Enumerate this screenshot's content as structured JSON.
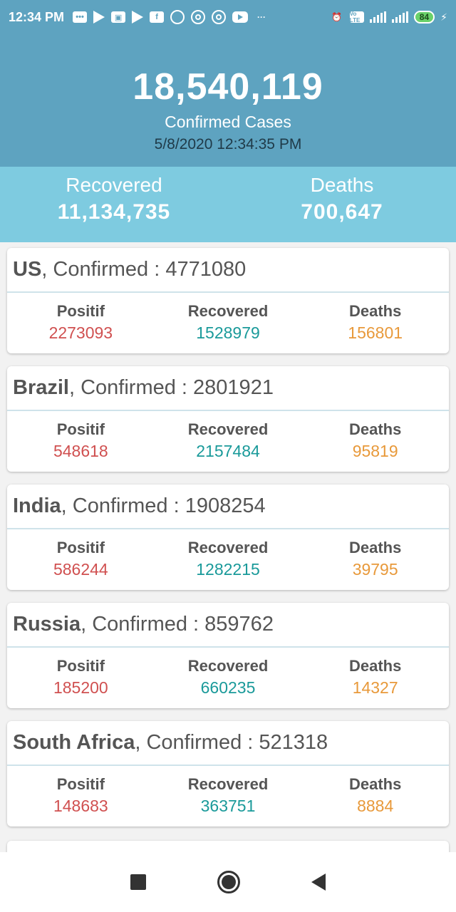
{
  "status_bar": {
    "time": "12:34 PM",
    "icons": [
      "message-icon",
      "play-store-icon",
      "gallery-icon",
      "play-store-icon",
      "facebook-icon",
      "messenger-icon",
      "circle-icon",
      "circle-icon",
      "youtube-icon",
      "more-icon"
    ],
    "more": "···",
    "volte": "Vo LTE",
    "network": "4G",
    "battery": "84"
  },
  "header": {
    "total": "18,540,119",
    "total_label": "Confirmed Cases",
    "updated": "5/8/2020 12:34:35 PM"
  },
  "summary": {
    "recovered_label": "Recovered",
    "recovered_value": "11,134,735",
    "deaths_label": "Deaths",
    "deaths_value": "700,647"
  },
  "labels": {
    "confirmed_prefix": ", Confirmed : ",
    "positif": "Positif",
    "recovered": "Recovered",
    "deaths": "Deaths"
  },
  "countries": [
    {
      "name": "US",
      "confirmed": "4771080",
      "positif": "2273093",
      "recovered": "1528979",
      "deaths": "156801"
    },
    {
      "name": "Brazil",
      "confirmed": "2801921",
      "positif": "548618",
      "recovered": "2157484",
      "deaths": "95819"
    },
    {
      "name": "India",
      "confirmed": "1908254",
      "positif": "586244",
      "recovered": "1282215",
      "deaths": "39795"
    },
    {
      "name": "Russia",
      "confirmed": "859762",
      "positif": "185200",
      "recovered": "660235",
      "deaths": "14327"
    },
    {
      "name": "South Africa",
      "confirmed": "521318",
      "positif": "148683",
      "recovered": "363751",
      "deaths": "8884"
    }
  ],
  "colors": {
    "header_bg": "#5ea3c0",
    "subheader_bg": "#7ecbe0",
    "positif": "#d05050",
    "recovered": "#1a9a9a",
    "deaths": "#e8993a"
  }
}
